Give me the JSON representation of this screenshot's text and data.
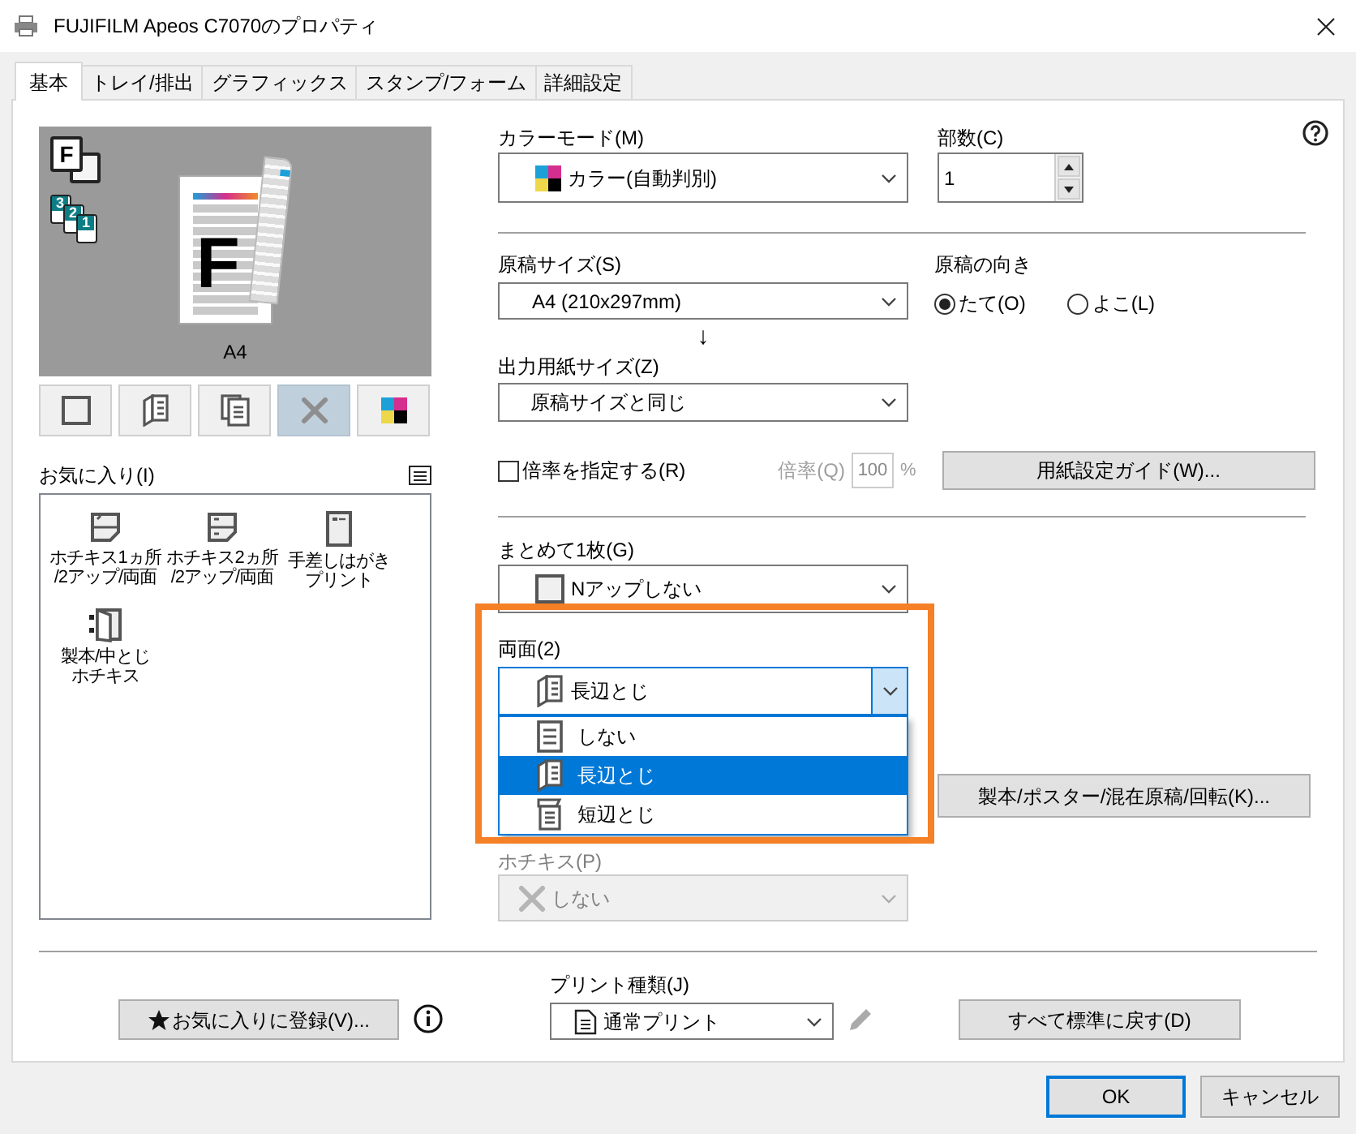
{
  "window": {
    "title": "FUJIFILM Apeos C7070のプロパティ"
  },
  "tabs": [
    {
      "label": "基本",
      "selected": true
    },
    {
      "label": "トレイ/排出",
      "selected": false
    },
    {
      "label": "グラフィックス",
      "selected": false
    },
    {
      "label": "スタンプ/フォーム",
      "selected": false
    },
    {
      "label": "詳細設定",
      "selected": false
    }
  ],
  "preview": {
    "badge_letter": "F",
    "stack_numbers": [
      "3",
      "2",
      "1"
    ],
    "page_letter": "F",
    "paper_label": "A4"
  },
  "view_buttons": [
    {
      "kind": "single",
      "selected": false
    },
    {
      "kind": "duplex",
      "selected": false
    },
    {
      "kind": "copies",
      "selected": false
    },
    {
      "kind": "staple",
      "selected": true
    },
    {
      "kind": "color",
      "selected": false
    }
  ],
  "favorites": {
    "label": "お気に入り(I)",
    "items": [
      {
        "kind": "staple1",
        "lines": [
          "ホチキス1ヵ所",
          "/2アップ/両面"
        ]
      },
      {
        "kind": "staple2",
        "lines": [
          "ホチキス2ヵ所",
          "/2アップ/両面"
        ]
      },
      {
        "kind": "postcard",
        "lines": [
          "手差しはがき",
          "プリント"
        ]
      },
      {
        "kind": "booklet",
        "lines": [
          "製本/中とじ",
          "ホチキス"
        ]
      }
    ]
  },
  "color_mode": {
    "label": "カラーモード(M)",
    "value": "カラー(自動判別)"
  },
  "copies": {
    "label": "部数(C)",
    "value": "1"
  },
  "original_size": {
    "label": "原稿サイズ(S)",
    "value": "A4 (210x297mm)"
  },
  "orientation": {
    "label": "原稿の向き",
    "options": [
      {
        "label": "たて(O)",
        "selected": true
      },
      {
        "label": "よこ(L)",
        "selected": false
      }
    ]
  },
  "arrow": "↓",
  "output_size": {
    "label": "出力用紙サイズ(Z)",
    "value": "原稿サイズと同じ"
  },
  "scale": {
    "label": "倍率を指定する(R)",
    "checked": false,
    "field_label": "倍率(Q)",
    "value": "100",
    "unit": "%",
    "disabled": true
  },
  "paper_guide_button": "用紙設定ガイド(W)...",
  "nup": {
    "label": "まとめて1枚(G)",
    "value": "Nアップしない"
  },
  "duplex": {
    "label": "両面(2)",
    "value": "長辺とじ",
    "expanded": true,
    "options": [
      {
        "kind": "none",
        "label": "しない",
        "selected": false
      },
      {
        "kind": "long",
        "label": "長辺とじ",
        "selected": true
      },
      {
        "kind": "short",
        "label": "短辺とじ",
        "selected": false
      }
    ]
  },
  "booklet_button": "製本/ポスター/混在原稿/回転(K)...",
  "staple": {
    "label": "ホチキス(P)",
    "value": "しない",
    "disabled": true
  },
  "favorite_add_button": "お気に入りに登録(V)...",
  "print_type": {
    "label": "プリント種類(J)",
    "value": "通常プリント"
  },
  "reset_button": "すべて標準に戻す(D)",
  "buttons": [
    {
      "label": "OK",
      "default": true
    },
    {
      "label": "キャンセル",
      "default": false
    }
  ]
}
